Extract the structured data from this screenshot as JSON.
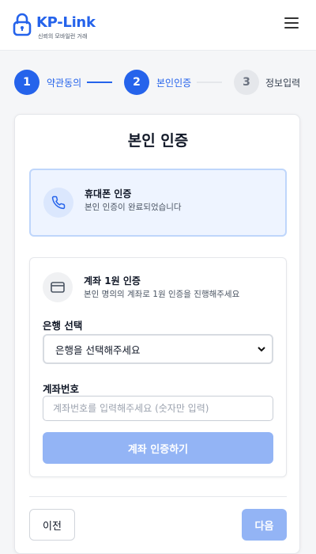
{
  "header": {
    "brand": "KP-Link",
    "tagline": "신뢰의 모바일런 거래",
    "logo_icon": "lock-icon",
    "menu_icon": "hamburger-menu-icon"
  },
  "steps": [
    {
      "number": "1",
      "label": "약관동의",
      "state": "completed"
    },
    {
      "number": "2",
      "label": "본인인증",
      "state": "current"
    },
    {
      "number": "3",
      "label": "정보입력",
      "state": "pending"
    }
  ],
  "card": {
    "title": "본인 인증",
    "phone_verification": {
      "icon": "phone-icon",
      "title": "휴대폰 인증",
      "subtitle": "본인 인증이 완료되었습니다"
    },
    "account_verification": {
      "icon": "credit-card-icon",
      "title": "계좌 1원 인증",
      "subtitle": "본인 명의의 계좌로 1원 인증을 진행해주세요",
      "bank_label": "은행 선택",
      "bank_select_value": "은행을 선택해주세요",
      "account_label": "계좌번호",
      "account_placeholder": "계좌번호를 입력해주세요 (숫자만 입력)",
      "account_value": "",
      "verify_button": "계좌 인증하기"
    },
    "prev_button": "이전",
    "next_button": "다음"
  },
  "colors": {
    "primary": "#2563eb",
    "primary_disabled": "#93b4f5",
    "verified_bg": "#eef4ff",
    "verified_border": "#bfd6fb"
  }
}
